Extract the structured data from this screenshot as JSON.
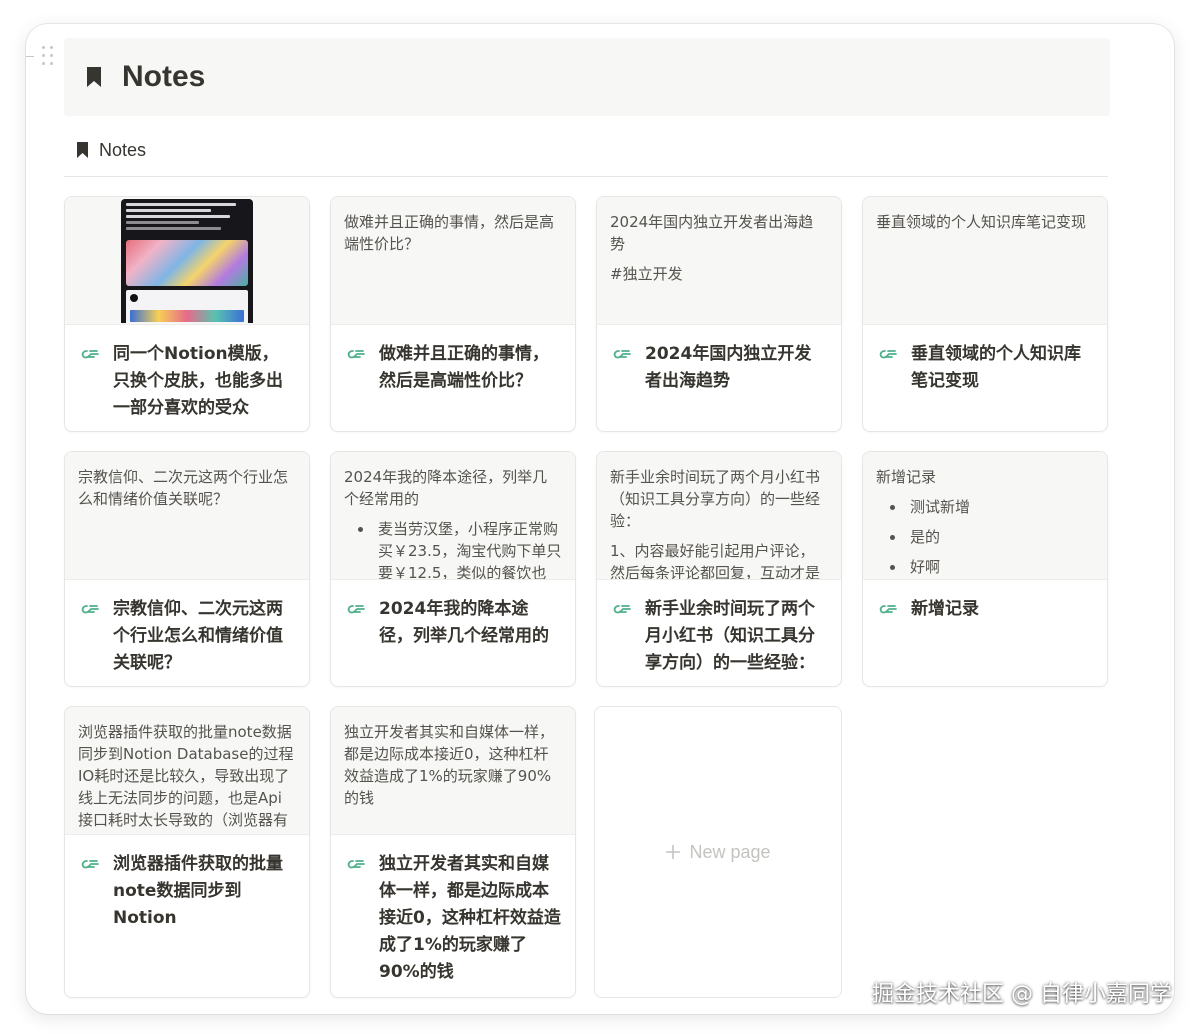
{
  "header": {
    "title": "Notes"
  },
  "view_tab": {
    "label": "Notes"
  },
  "cards": [
    {
      "preview_kind": "image",
      "title": "同一个Notion模版，只换个皮肤，也能多出一部分喜欢的受众"
    },
    {
      "preview_kind": "text",
      "preview_paragraphs": [
        "做难并且正确的事情，然后是高端性价比？"
      ],
      "title": "做难并且正确的事情，然后是高端性价比？"
    },
    {
      "preview_kind": "text",
      "preview_paragraphs": [
        "2024年国内独立开发者出海趋势",
        "#独立开发"
      ],
      "title": "2024年国内独立开发者出海趋势"
    },
    {
      "preview_kind": "text",
      "preview_paragraphs": [
        "垂直领域的个人知识库笔记变现"
      ],
      "title": "垂直领域的个人知识库笔记变现"
    },
    {
      "preview_kind": "text",
      "preview_paragraphs": [
        "宗教信仰、二次元这两个行业怎么和情绪价值关联呢？"
      ],
      "title": "宗教信仰、二次元这两个行业怎么和情绪价值关联呢？"
    },
    {
      "preview_kind": "text",
      "preview_paragraphs": [
        "2024年我的降本途径，列举几个经常用的"
      ],
      "preview_bullets": [
        "麦当劳汉堡，小程序正常购买￥23.5，淘宝代购下单只要￥12.5，类似的餐饮也"
      ],
      "title": "2024年我的降本途径，列举几个经常用的"
    },
    {
      "preview_kind": "text",
      "preview_paragraphs": [
        "新手业余时间玩了两个月小红书（知识工具分享方向）的一些经验：",
        "1、内容最好能引起用户评论，然后每条评论都回复，互动才是"
      ],
      "title": "新手业余时间玩了两个月小红书（知识工具分享方向）的一些经验："
    },
    {
      "preview_kind": "text",
      "preview_paragraphs": [
        "新增记录"
      ],
      "preview_bullets": [
        "测试新增",
        "是的",
        "好啊"
      ],
      "title": "新增记录"
    },
    {
      "preview_kind": "text",
      "preview_paragraphs": [
        "浏览器插件获取的批量note数据同步到Notion Database的过程IO耗时还是比较久，导致出现了线上无法同步的问题，也是Api接口耗时太长导致的（浏览器有"
      ],
      "title": "浏览器插件获取的批量note数据同步到Notion"
    },
    {
      "preview_kind": "text",
      "preview_paragraphs": [
        "独立开发者其实和自媒体一样，都是边际成本接近0，这种杠杆效益造成了1%的玩家赚了90%的钱"
      ],
      "title": "独立开发者其实和自媒体一样，都是边际成本接近0，这种杠杆效益造成了1%的玩家赚了90%的钱"
    }
  ],
  "new_page": {
    "label": "New page"
  },
  "watermark": "掘金技术社区 @ 自律小嘉同学",
  "colors": {
    "accent_icon": "#4fb08a",
    "text": "#37352f",
    "preview_bg": "#f7f7f5"
  }
}
